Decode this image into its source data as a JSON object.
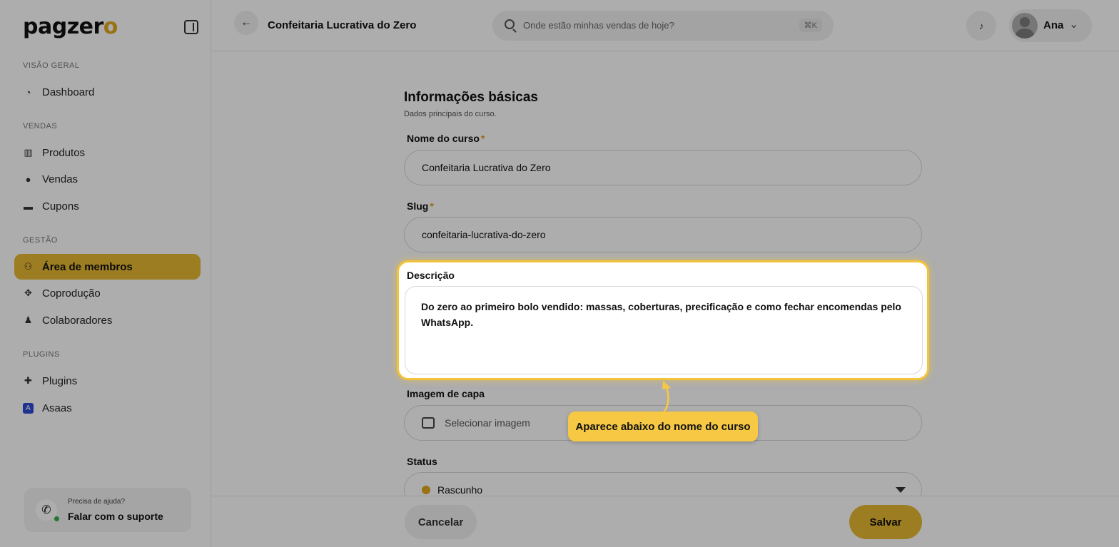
{
  "brand": {
    "logo_main": "pagzer",
    "logo_accent": "o",
    "accent_color": "#e6b833"
  },
  "sidebar": {
    "sections": [
      {
        "label": "VISÃO GERAL"
      },
      {
        "label": "VENDAS"
      },
      {
        "label": "GESTÃO"
      },
      {
        "label": "PLUGINS"
      }
    ],
    "items": [
      {
        "label": "Dashboard",
        "icon": "dashboard-icon"
      },
      {
        "label": "Produtos",
        "icon": "products-icon"
      },
      {
        "label": "Vendas",
        "icon": "sales-icon"
      },
      {
        "label": "Cupons",
        "icon": "coupon-icon"
      },
      {
        "label": "Área de membros",
        "icon": "members-icon",
        "active": true
      },
      {
        "label": "Coprodução",
        "icon": "handshake-icon"
      },
      {
        "label": "Colaboradores",
        "icon": "collaborators-icon"
      },
      {
        "label": "Plugins",
        "icon": "puzzle-icon"
      },
      {
        "label": "Asaas",
        "icon": "asaas-icon"
      }
    ],
    "support": {
      "question": "Precisa de ajuda?",
      "link": "Falar com o suporte"
    }
  },
  "topbar": {
    "title": "Confeitaria Lucrativa do Zero",
    "search_placeholder": "Onde estão minhas vendas de hoje?",
    "shortcut": "⌘K",
    "user_name": "Ana"
  },
  "form": {
    "section_title": "Informações básicas",
    "section_subtitle": "Dados principais do curso.",
    "name_label": "Nome do curso",
    "name_value": "Confeitaria Lucrativa do Zero",
    "slug_label": "Slug",
    "slug_value": "confeitaria-lucrativa-do-zero",
    "required_mark": "*",
    "description_label": "Descrição",
    "description_value": "Do zero ao primeiro bolo vendido: massas, coberturas, precificação e como fechar encomendas pelo WhatsApp.",
    "cover_label": "Imagem de capa",
    "cover_placeholder": "Selecionar imagem",
    "status_label": "Status",
    "status_value": "Rascunho"
  },
  "footer": {
    "cancel": "Cancelar",
    "save": "Salvar"
  },
  "tooltip": {
    "text": "Aparece abaixo do nome do curso"
  }
}
